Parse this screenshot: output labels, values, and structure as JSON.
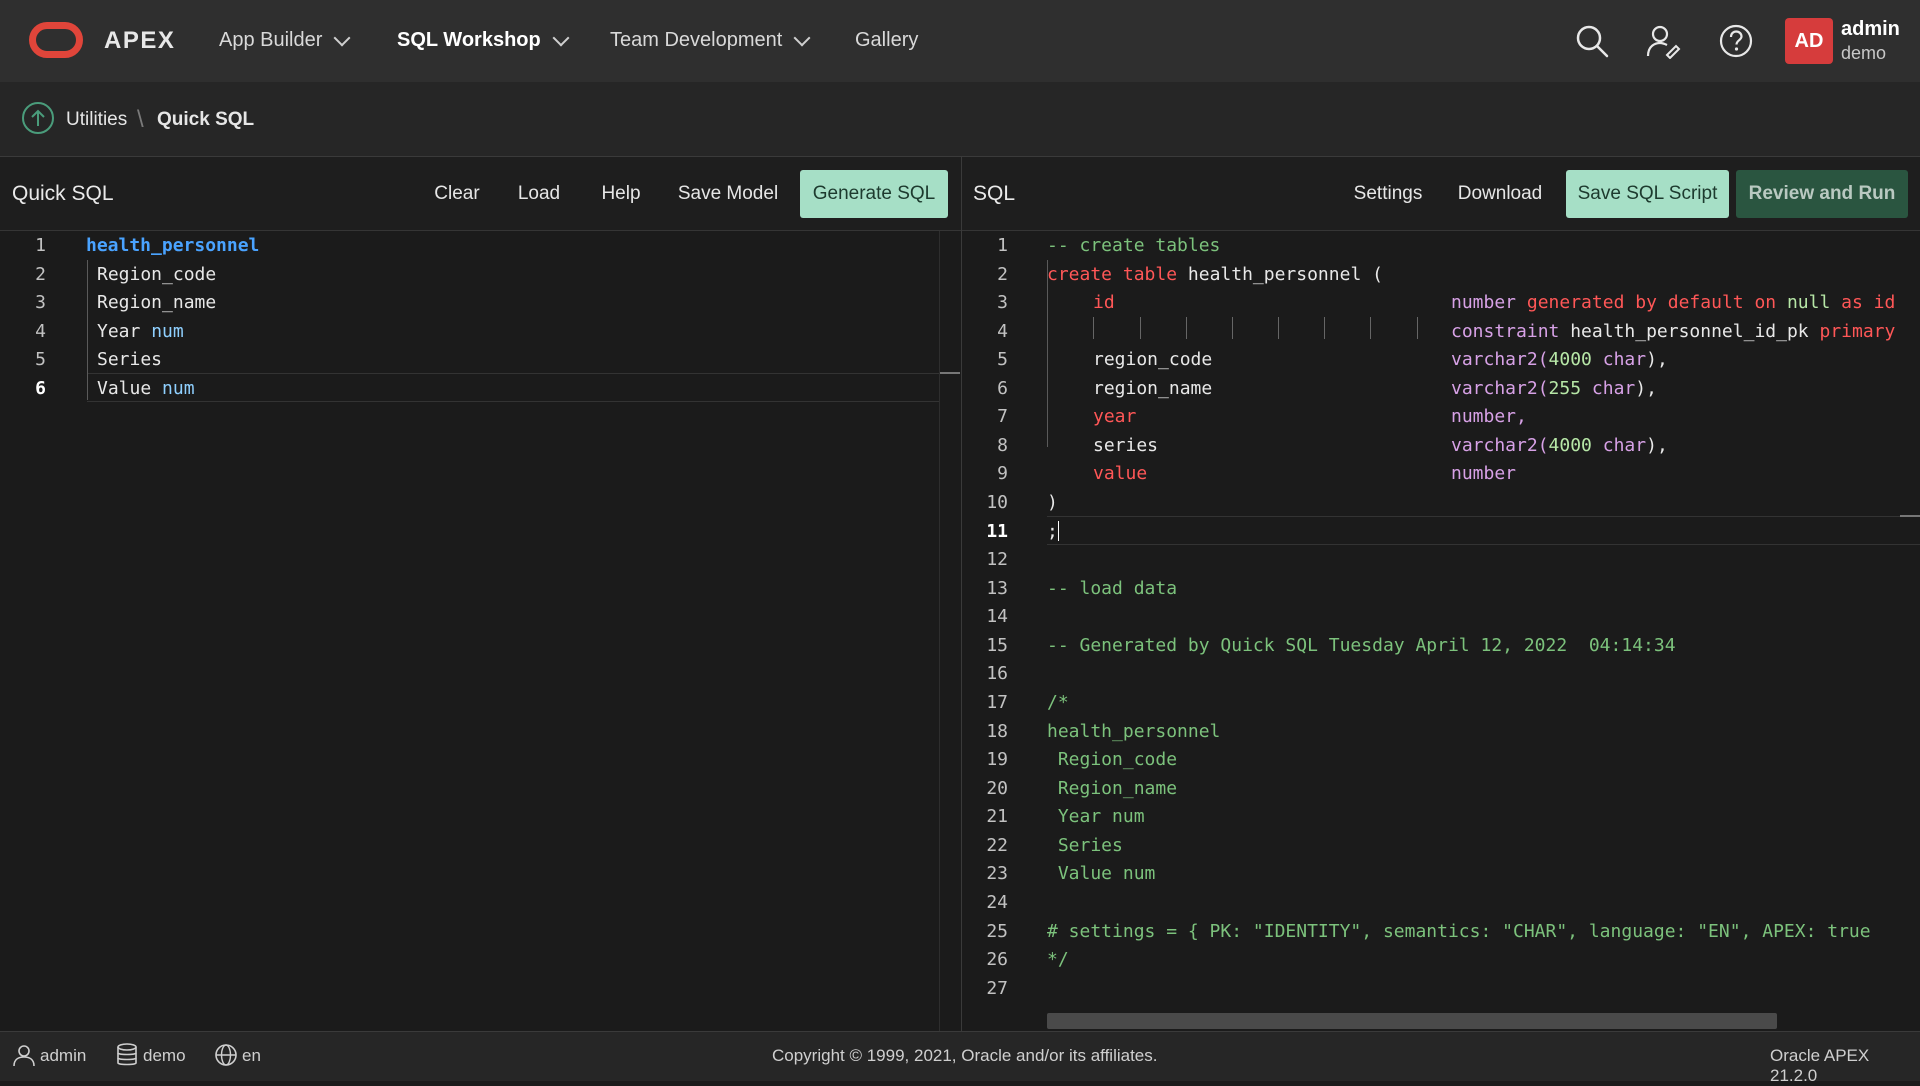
{
  "header": {
    "brand": "APEX",
    "nav": [
      {
        "label": "App Builder",
        "dropdown": true,
        "active": false
      },
      {
        "label": "SQL Workshop",
        "dropdown": true,
        "active": true
      },
      {
        "label": "Team Development",
        "dropdown": true,
        "active": false
      },
      {
        "label": "Gallery",
        "dropdown": false,
        "active": false
      }
    ],
    "icons": [
      "search-icon",
      "user-settings-icon",
      "help-icon"
    ],
    "user": {
      "initials": "AD",
      "name": "admin",
      "workspace": "demo"
    },
    "colors": {
      "logo": "#e0453a",
      "avatar": "#d63c3c"
    }
  },
  "breadcrumb": {
    "parent": "Utilities",
    "current": "Quick SQL"
  },
  "left_panel": {
    "title": "Quick SQL",
    "buttons": {
      "clear": "Clear",
      "load": "Load",
      "help": "Help",
      "save_model": "Save Model",
      "generate": "Generate SQL"
    },
    "lines": [
      {
        "n": "1",
        "text": "health_personnel"
      },
      {
        "n": "2",
        "text": "Region_code"
      },
      {
        "n": "3",
        "text": "Region_name"
      },
      {
        "n": "4",
        "text": "Year",
        "type": "num"
      },
      {
        "n": "5",
        "text": "Series"
      },
      {
        "n": "6",
        "text": "Value",
        "type": "num"
      }
    ],
    "current_line": "6"
  },
  "right_panel": {
    "title": "SQL",
    "buttons": {
      "settings": "Settings",
      "download": "Download",
      "save_script": "Save SQL Script",
      "review_run": "Review and Run"
    },
    "line_numbers": [
      "1",
      "2",
      "3",
      "4",
      "5",
      "6",
      "7",
      "8",
      "9",
      "10",
      "11",
      "12",
      "13",
      "14",
      "15",
      "16",
      "17",
      "18",
      "19",
      "20",
      "21",
      "22",
      "23",
      "24",
      "25",
      "26",
      "27"
    ],
    "current_line": "11",
    "code": {
      "l1": "-- create tables",
      "l2_kw": "create table",
      "l2_name": "health_personnel (",
      "l3_col": "id",
      "l3_type": "number",
      "l3_rest": "generated by default on",
      "l3_null": "null",
      "l3_as": "as id",
      "l4_kw": "constraint",
      "l4_name": "health_personnel_id_pk",
      "l4_rest": "primary",
      "l5_col": "region_code",
      "l5_type": "varchar2(",
      "l5_num": "4000",
      "l5_char": "char",
      "l5_end": "),",
      "l6_col": "region_name",
      "l6_type": "varchar2(",
      "l6_num": "255",
      "l6_char": "char",
      "l6_end": "),",
      "l7_col": "year",
      "l7_type": "number,",
      "l8_col": "series",
      "l8_type": "varchar2(",
      "l8_num": "4000",
      "l8_char": "char",
      "l8_end": "),",
      "l9_col": "value",
      "l9_type": "number",
      "l10": ")",
      "l11": ";",
      "l13": "-- load data",
      "l15": "-- Generated by Quick SQL Tuesday April 12, 2022  04:14:34",
      "l17": "/*",
      "l18": "health_personnel",
      "l19": " Region_code",
      "l20": " Region_name",
      "l21": " Year num",
      "l22": " Series",
      "l23": " Value num",
      "l25": "# settings = { PK: \"IDENTITY\", semantics: \"CHAR\", language: \"EN\", APEX: true",
      "l26": "*/"
    }
  },
  "footer": {
    "user": "admin",
    "workspace": "demo",
    "language": "en",
    "copyright": "Copyright © 1999, 2021, Oracle and/or its affiliates.",
    "version": "Oracle APEX 21.2.0"
  }
}
